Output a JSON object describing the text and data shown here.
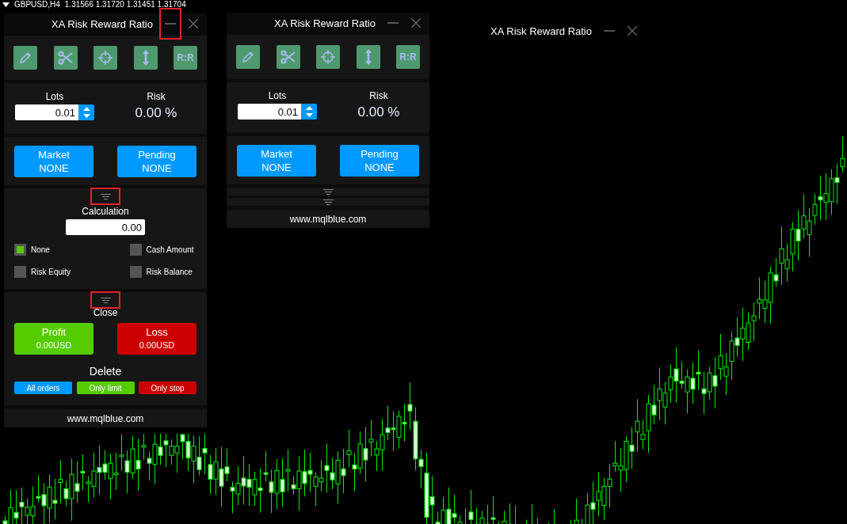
{
  "chart": {
    "symbol": "GBPUSD,H4",
    "prices": "1.31566 1.31720 1.31451 1.31704"
  },
  "panels": [
    {
      "title": "XA Risk Reward Ratio",
      "minimized": false,
      "minimize_highlighted": true,
      "tools": [
        {
          "kind": "pencil"
        },
        {
          "kind": "scissors"
        },
        {
          "kind": "crosshair"
        },
        {
          "kind": "updown"
        },
        {
          "kind": "text",
          "label": "R:R"
        }
      ],
      "lots": {
        "label": "Lots",
        "value": "0.01"
      },
      "risk": {
        "label": "Risk",
        "value": "0.00 %"
      },
      "orders": [
        {
          "label": "Market",
          "value": "NONE"
        },
        {
          "label": "Pending",
          "value": "NONE"
        }
      ],
      "calculation": {
        "expanded": true,
        "highlighted": true,
        "label": "Calculation",
        "value": "0.00",
        "options": [
          {
            "label": "None",
            "checked": true
          },
          {
            "label": "Cash Amount",
            "checked": false
          },
          {
            "label": "Risk Equity",
            "checked": false
          },
          {
            "label": "Risk Balance",
            "checked": false
          }
        ]
      },
      "close": {
        "expanded": true,
        "highlighted": true,
        "label": "Close",
        "buttons": [
          {
            "label": "Profit",
            "value": "0.00USD",
            "color": "#55cc00"
          },
          {
            "label": "Loss",
            "value": "0.00USD",
            "color": "#cc0000"
          }
        ],
        "delete_label": "Delete",
        "delete_buttons": [
          {
            "label": "All orders",
            "color": "#0099ff"
          },
          {
            "label": "Only limit",
            "color": "#55cc00"
          },
          {
            "label": "Only stop",
            "color": "#cc0000"
          }
        ]
      },
      "footer": "www.mqlblue.com"
    },
    {
      "title": "XA Risk Reward Ratio",
      "minimized": false,
      "minimize_highlighted": false,
      "tools": [
        {
          "kind": "pencil"
        },
        {
          "kind": "scissors"
        },
        {
          "kind": "crosshair"
        },
        {
          "kind": "updown"
        },
        {
          "kind": "text",
          "label": "R:R"
        }
      ],
      "lots": {
        "label": "Lots",
        "value": "0.01"
      },
      "risk": {
        "label": "Risk",
        "value": "0.00 %"
      },
      "orders": [
        {
          "label": "Market",
          "value": "NONE"
        },
        {
          "label": "Pending",
          "value": "NONE"
        }
      ],
      "calculation": {
        "expanded": false,
        "highlighted": false
      },
      "close": {
        "expanded": false,
        "highlighted": false
      },
      "footer": "www.mqlblue.com"
    },
    {
      "title": "XA Risk Reward Ratio",
      "minimized": true,
      "minimize_highlighted": false
    }
  ]
}
